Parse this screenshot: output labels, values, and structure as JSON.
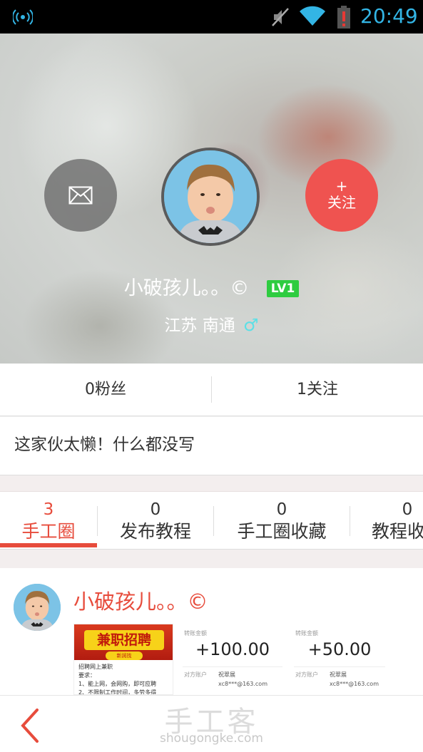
{
  "status_bar": {
    "time": "20:49"
  },
  "profile": {
    "username": "小破孩儿。。©",
    "level": "LV1",
    "location": "江苏  南通",
    "gender_symbol": "♂",
    "follow_label": "关注",
    "follow_plus": "+"
  },
  "stats": {
    "fans": "0粉丝",
    "following": "1关注"
  },
  "bio": "这家伙太懒！什么都没写",
  "tabs": [
    {
      "count": "3",
      "label": "手工圈"
    },
    {
      "count": "0",
      "label": "发布教程"
    },
    {
      "count": "0",
      "label": "手工圈收藏"
    },
    {
      "count": "0",
      "label": "教程收藏"
    }
  ],
  "feed": {
    "author": "小破孩儿。。©",
    "poster": {
      "headline": "兼职招聘",
      "sub": "新润找",
      "line1": "招聘网上兼职",
      "line2": "要求：",
      "line3": "1、能上网，会网购，即可应聘",
      "line4": "2、不限制工作时间，多劳多得"
    },
    "receipts": [
      {
        "label": "转账金额",
        "amount": "+100.00",
        "payee_label": "对方账户",
        "payee": "祝翠展",
        "email": "xc8***@163.com"
      },
      {
        "label": "转账金额",
        "amount": "+50.00",
        "payee_label": "对方账户",
        "payee": "祝翠展",
        "email": "xc8***@163.com"
      }
    ]
  },
  "watermark": {
    "cn": "手工客",
    "en": "shougongke.com"
  },
  "colors": {
    "accent": "#e74c3c",
    "follow": "#ef5350",
    "level": "#2ecc40",
    "status": "#33b5e5"
  }
}
